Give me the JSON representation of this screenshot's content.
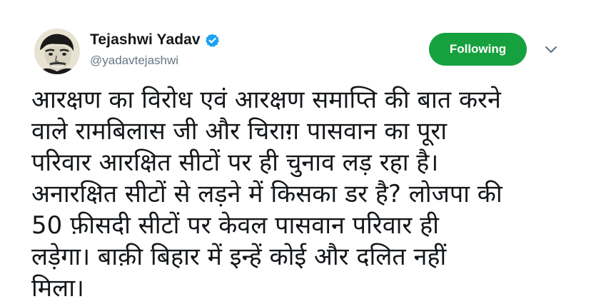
{
  "tweet": {
    "author": {
      "name": "Tejashwi Yadav",
      "handle": "@yadavtejashwi",
      "verified_icon": "verified-badge-icon",
      "avatar_icon": "avatar"
    },
    "follow_button": {
      "label": "Following",
      "color": "#17a13e"
    },
    "menu_icon": "chevron-down-icon",
    "text_lines": [
      "आरक्षण का विरोध एवं आरक्षण समाप्ति की बात करने",
      "वाले रामबिलास जी और चिराग़ पासवान का पूरा",
      "परिवार आरक्षित सीटों पर ही चुनाव लड़ रहा है।",
      "अनारक्षित सीटों से लड़ने में किसका डर है? लोजपा की",
      "50 फ़ीसदी सीटों पर केवल पासवान परिवार ही",
      "लड़ेगा। बाक़ी बिहार में इन्हें कोई और दलित नहीं",
      "मिला।"
    ]
  },
  "colors": {
    "name": "#14171a",
    "handle": "#657786",
    "verified": "#1da1f2",
    "following_bg": "#17a13e"
  }
}
